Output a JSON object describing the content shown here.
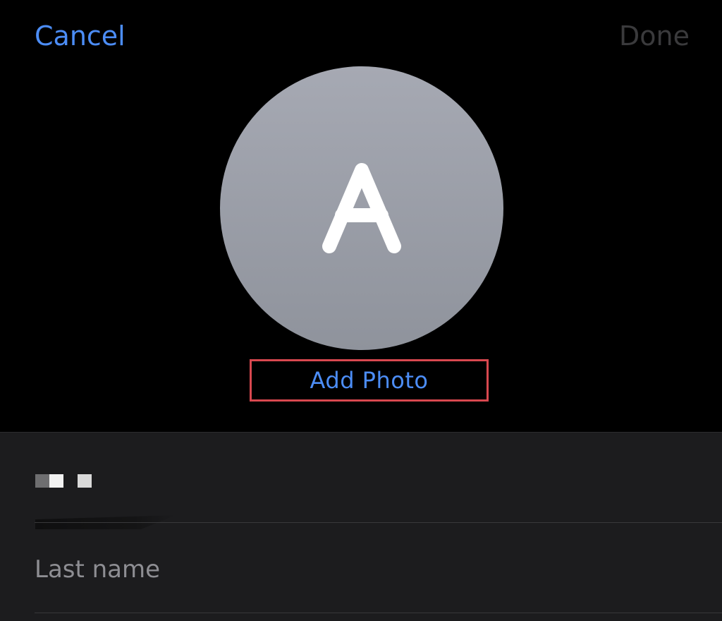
{
  "nav": {
    "cancel_label": "Cancel",
    "done_label": "Done"
  },
  "avatar": {
    "initial": "A"
  },
  "add_photo": {
    "label": "Add Photo"
  },
  "form": {
    "first_name_value": "",
    "last_name_placeholder": "Last name"
  },
  "colors": {
    "accent": "#4c8df6",
    "done_disabled": "#3a3a3c",
    "background": "#000000",
    "form_background": "#1c1c1e",
    "highlight_box": "#d8484f",
    "avatar": "#9a9da6"
  },
  "icons": {
    "avatar": "initial-letter-avatar"
  }
}
